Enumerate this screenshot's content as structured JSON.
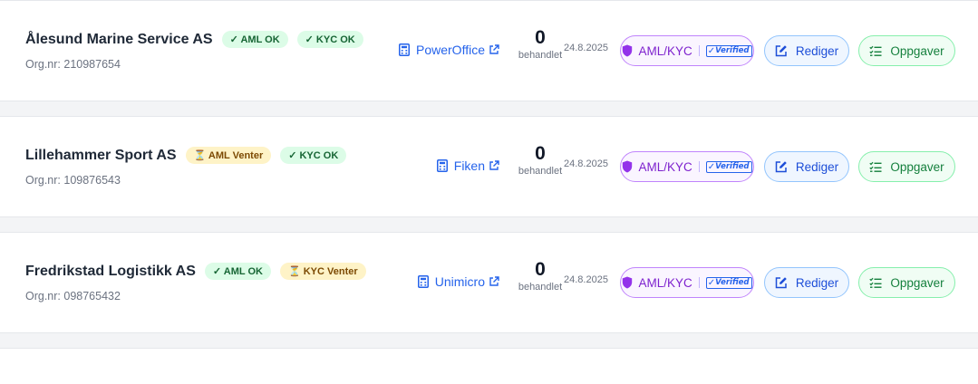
{
  "companies": [
    {
      "name": "Ålesund Marine Service AS",
      "aml_badge": "✓ AML OK",
      "aml_status": "ok",
      "kyc_badge": "✓ KYC OK",
      "kyc_status": "ok",
      "orgnr": "Org.nr: 210987654",
      "integration": "PowerOffice",
      "count": "0",
      "count_label": "behandlet",
      "date": "24.8.2025"
    },
    {
      "name": "Lillehammer Sport AS",
      "aml_badge": "⏳ AML Venter",
      "aml_status": "waiting",
      "kyc_badge": "✓ KYC OK",
      "kyc_status": "ok",
      "orgnr": "Org.nr: 109876543",
      "integration": "Fiken",
      "count": "0",
      "count_label": "behandlet",
      "date": "24.8.2025"
    },
    {
      "name": "Fredrikstad Logistikk AS",
      "aml_badge": "✓ AML OK",
      "aml_status": "ok",
      "kyc_badge": "⏳ KYC Venter",
      "kyc_status": "waiting",
      "orgnr": "Org.nr: 098765432",
      "integration": "Unimicro",
      "count": "0",
      "count_label": "behandlet",
      "date": "24.8.2025"
    }
  ],
  "actions": {
    "aml_kyc_label": "AML/KYC",
    "verified_label": "Verified",
    "edit_label": "Rediger",
    "tasks_label": "Oppgaver"
  },
  "icons": {
    "integration": "calculator-icon",
    "external": "external-link-icon",
    "aml": "shield-icon",
    "edit": "edit-icon",
    "tasks": "task-list-icon"
  },
  "colors": {
    "ok_badge_bg": "#dcfce7",
    "waiting_badge_bg": "#fef3c7",
    "link_blue": "#2563eb",
    "purple": "#7e22ce",
    "green": "#15803d"
  }
}
